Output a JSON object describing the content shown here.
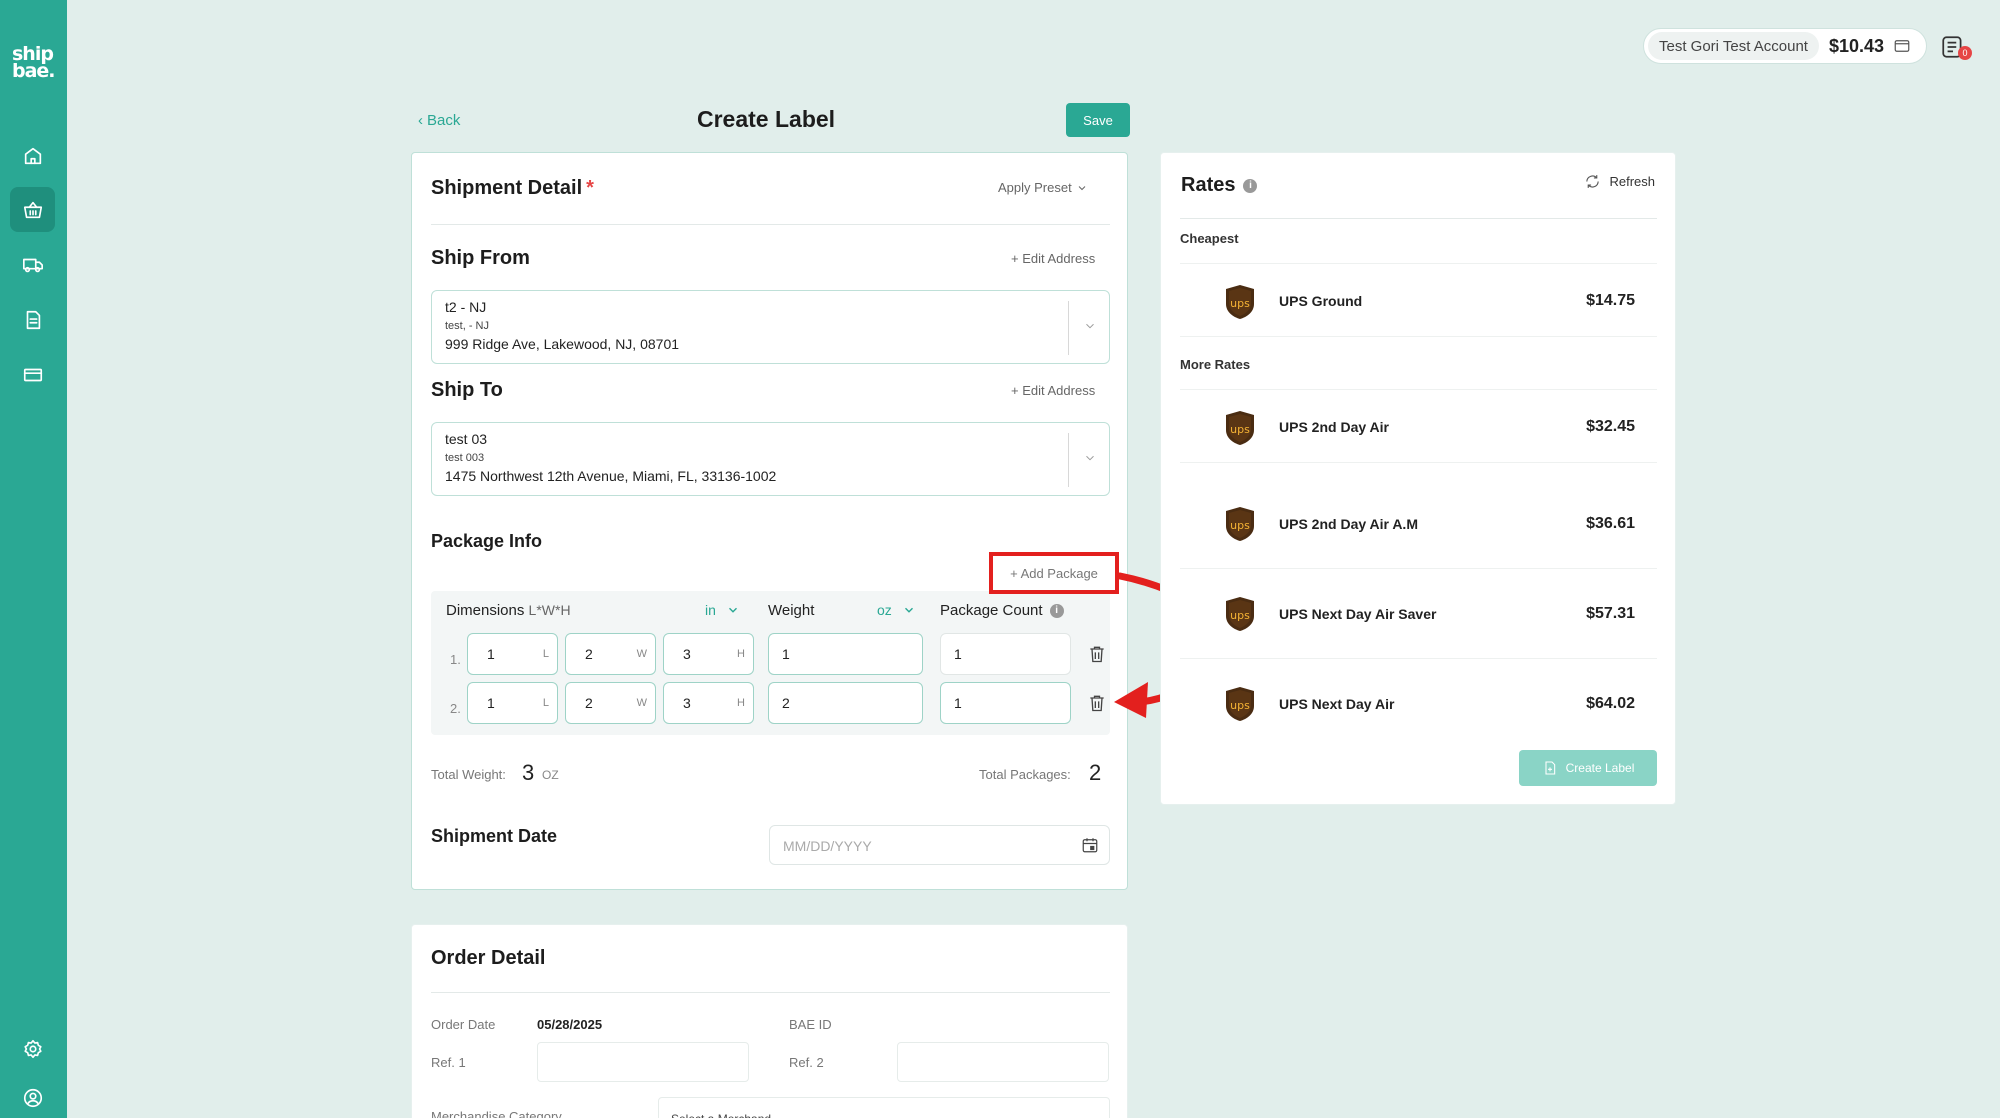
{
  "brand": {
    "logo_line1": "ship",
    "logo_line2": "bae."
  },
  "sidebar": {
    "items": [
      {
        "icon": "home-icon"
      },
      {
        "icon": "basket-icon",
        "active": true
      },
      {
        "icon": "truck-icon"
      },
      {
        "icon": "document-icon"
      },
      {
        "icon": "card-icon"
      },
      {
        "icon": "gear-icon"
      },
      {
        "icon": "user-icon"
      }
    ]
  },
  "account": {
    "name": "Test Gori Test Account",
    "balance": "$10.43",
    "notification_count": "0"
  },
  "header": {
    "back_label": "Back",
    "title": "Create Label",
    "save_label": "Save"
  },
  "shipment": {
    "title": "Shipment Detail",
    "required_mark": "*",
    "apply_preset": "Apply Preset",
    "ship_from": {
      "title": "Ship From",
      "edit_label": "+ Edit Address",
      "name": "t2 - NJ",
      "sub": "test, - NJ",
      "address": "999 Ridge Ave, Lakewood, NJ, 08701"
    },
    "ship_to": {
      "title": "Ship To",
      "edit_label": "+ Edit Address",
      "name": "test 03",
      "sub": "test 003",
      "address": "1475 Northwest 12th Avenue, Miami, FL, 33136-1002"
    },
    "package_info": {
      "title": "Package Info",
      "add_package": "+ Add Package",
      "dimensions_label": "Dimensions",
      "dimensions_hint": "L*W*H",
      "dimension_unit": "in",
      "weight_label": "Weight",
      "weight_unit": "oz",
      "count_label": "Package Count",
      "suffix_l": "L",
      "suffix_w": "W",
      "suffix_h": "H",
      "rows": [
        {
          "num": "1.",
          "l": "1",
          "w": "2",
          "h": "3",
          "weight": "1",
          "count": "1"
        },
        {
          "num": "2.",
          "l": "1",
          "w": "2",
          "h": "3",
          "weight": "2",
          "count": "1"
        }
      ],
      "total_weight_label": "Total Weight:",
      "total_weight": "3",
      "total_weight_unit": "OZ",
      "total_packages_label": "Total Packages:",
      "total_packages": "2"
    },
    "shipment_date": {
      "title": "Shipment Date",
      "placeholder": "MM/DD/YYYY"
    }
  },
  "order": {
    "title": "Order Detail",
    "order_date_label": "Order Date",
    "order_date": "05/28/2025",
    "bae_id_label": "BAE ID",
    "ref1_label": "Ref. 1",
    "ref2_label": "Ref. 2",
    "merch_label": "Merchandise Category",
    "merch_placeholder": "Select a Merchand"
  },
  "rates": {
    "title": "Rates",
    "info": "i",
    "refresh_label": "Refresh",
    "cheapest_label": "Cheapest",
    "cheapest": {
      "name": "UPS Ground",
      "price": "$14.75"
    },
    "more_label": "More Rates",
    "more": [
      {
        "name": "UPS 2nd Day Air",
        "price": "$32.45"
      },
      {
        "name": "UPS 2nd Day Air A.M",
        "price": "$36.61"
      },
      {
        "name": "UPS Next Day Air Saver",
        "price": "$57.31"
      },
      {
        "name": "UPS Next Day Air",
        "price": "$64.02"
      }
    ],
    "create_label": "Create Label",
    "logo_text": "ups"
  },
  "colors": {
    "accent": "#2aa894",
    "highlight": "#e3201e",
    "ups_brown": "#4a2c12",
    "ups_gold": "#f5b335"
  }
}
